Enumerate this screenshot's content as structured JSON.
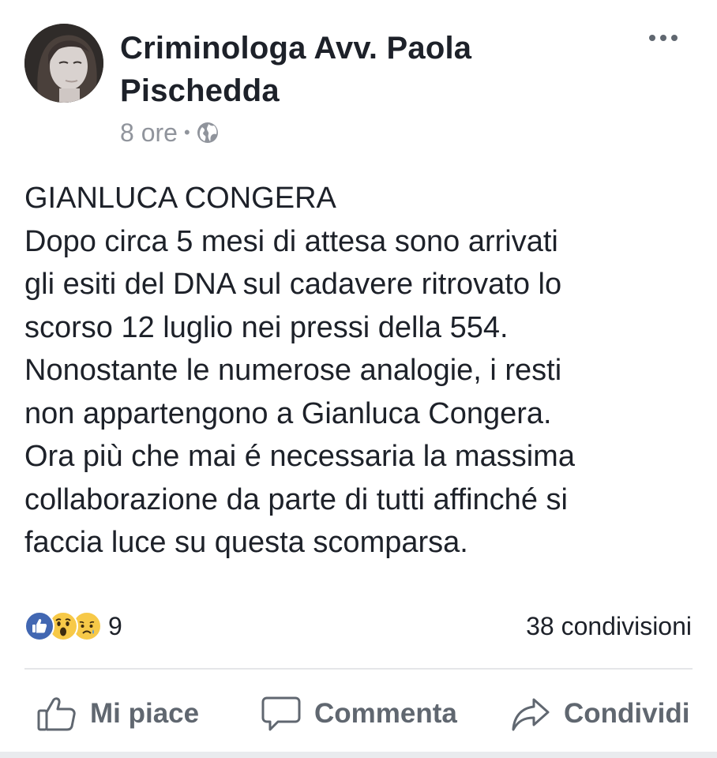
{
  "post": {
    "author": {
      "name_line1": "Criminologa Avv. Paola",
      "name_line2": "Pischedda",
      "avatar_icon": "profile-photo"
    },
    "meta": {
      "time": "8 ore",
      "separator": "•",
      "audience_icon": "globe-icon"
    },
    "more_icon": "ellipsis-icon",
    "body_lines": [
      "GIANLUCA CONGERA",
      "Dopo circa 5 mesi di attesa sono arrivati",
      "gli esiti del DNA sul cadavere ritrovato lo",
      "scorso 12 luglio nei pressi della 554.",
      "Nonostante le numerose analogie, i resti",
      "non appartengono a Gianluca Congera.",
      "Ora più che mai é necessaria la massima",
      "collaborazione da parte di tutti affinché si",
      "faccia luce su questa scomparsa."
    ],
    "reactions": {
      "icons": [
        "like-reaction-icon",
        "wow-reaction-icon",
        "sad-reaction-icon"
      ],
      "count": "9"
    },
    "shares": "38 condivisioni",
    "actions": {
      "like": "Mi piace",
      "comment": "Commenta",
      "share": "Condividi"
    },
    "colors": {
      "like_blue": "#4267b2",
      "emoji_yellow": "#f7c948",
      "muted_text": "#90949c",
      "action_text": "#606770"
    }
  }
}
